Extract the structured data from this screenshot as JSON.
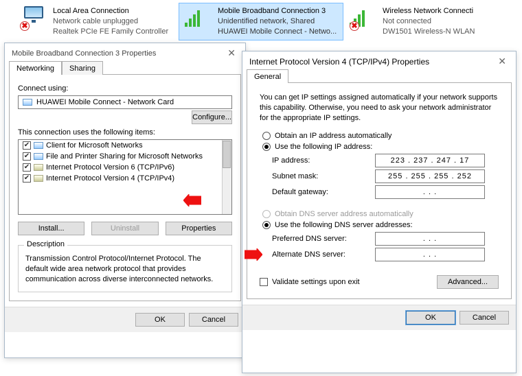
{
  "networks": [
    {
      "title": "Local Area Connection",
      "line2": "Network cable unplugged",
      "line3": "Realtek PCIe FE Family Controller"
    },
    {
      "title": "Mobile Broadband Connection 3",
      "line2": "Unidentified network, Shared",
      "line3": "HUAWEI Mobile Connect - Netwo..."
    },
    {
      "title": "Wireless Network Connecti",
      "line2": "Not connected",
      "line3": "DW1501 Wireless-N WLAN"
    }
  ],
  "win1": {
    "title": "Mobile Broadband Connection 3 Properties",
    "tabs": [
      "Networking",
      "Sharing"
    ],
    "connect_using": "Connect using:",
    "adapter": "HUAWEI Mobile Connect - Network Card",
    "configure": "Configure...",
    "items_label": "This connection uses the following items:",
    "items": [
      "Client for Microsoft Networks",
      "File and Printer Sharing for Microsoft Networks",
      "Internet Protocol Version 6 (TCP/IPv6)",
      "Internet Protocol Version 4 (TCP/IPv4)"
    ],
    "install": "Install...",
    "uninstall": "Uninstall",
    "properties": "Properties",
    "description_label": "Description",
    "description": "Transmission Control Protocol/Internet Protocol. The default wide area network protocol that provides communication across diverse interconnected networks.",
    "ok": "OK",
    "cancel": "Cancel"
  },
  "win2": {
    "title": "Internet Protocol Version 4 (TCP/IPv4) Properties",
    "tab": "General",
    "blurb": "You can get IP settings assigned automatically if your network supports this capability. Otherwise, you need to ask your network administrator for the appropriate IP settings.",
    "ip_auto": "Obtain an IP address automatically",
    "ip_manual": "Use the following IP address:",
    "ip_label": "IP address:",
    "mask_label": "Subnet mask:",
    "gw_label": "Default gateway:",
    "ip_value": "223 . 237 . 247 .  17",
    "mask_value": "255 . 255 . 255 . 252",
    "gw_value": ".          .          .",
    "dns_auto": "Obtain DNS server address automatically",
    "dns_manual": "Use the following DNS server addresses:",
    "pdns_label": "Preferred DNS server:",
    "adns_label": "Alternate DNS server:",
    "empty_ip": ".          .          .",
    "validate": "Validate settings upon exit",
    "advanced": "Advanced...",
    "ok": "OK",
    "cancel": "Cancel"
  }
}
